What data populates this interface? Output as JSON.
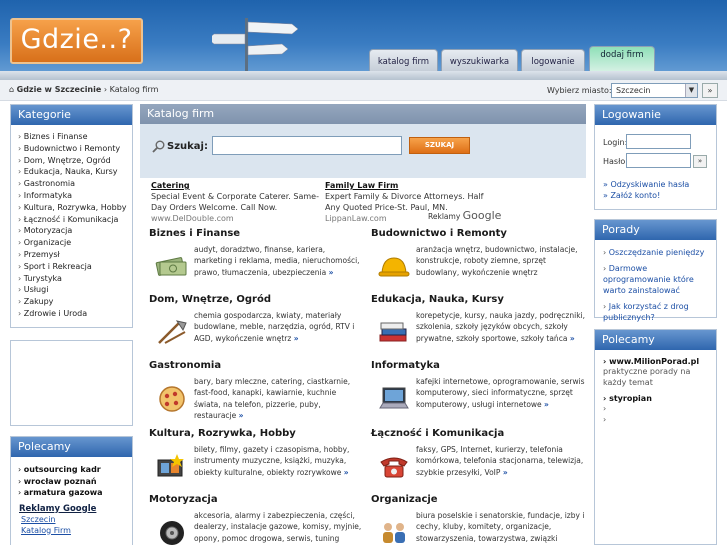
{
  "header": {
    "logo": "Gdzie..?",
    "tabs": [
      "katalog firm",
      "wyszukiwarka",
      "logowanie",
      "dodaj firm"
    ]
  },
  "breadcrumb": {
    "home": "Gdzie w Szczecinie",
    "current": "Katalog firm",
    "city_label": "Wybierz miasto:",
    "city_value": "Szczecin",
    "city_go": "»"
  },
  "kategorie": {
    "title": "Kategorie",
    "items": [
      "Biznes i Finanse",
      "Budownictwo i Remonty",
      "Dom, Wnętrze, Ogród",
      "Edukacja, Nauka, Kursy",
      "Gastronomia",
      "Informatyka",
      "Kultura, Rozrywka, Hobby",
      "Łączność i Komunikacja",
      "Motoryzacja",
      "Organizacje",
      "Przemysł",
      "Sport i Rekreacja",
      "Turystyka",
      "Usługi",
      "Zakupy",
      "Zdrowie i Uroda"
    ]
  },
  "polecany_left": {
    "title": "Polecamy",
    "items": [
      "outsourcing kadr",
      "wrocław poznań",
      "armatura gazowa"
    ],
    "reklamy": "Reklamy Google",
    "links": [
      "Szczecin",
      "Katalog Firm"
    ]
  },
  "center": {
    "title": "Katalog firm",
    "search_label": "Szukaj:",
    "search_value": "",
    "search_button": "SZUKAJ",
    "ads": [
      {
        "title": "Catering",
        "text": "Special Event & Corporate Caterer. Same-Day Orders Welcome. Call Now.",
        "url": "www.DelDouble.com"
      },
      {
        "title": "Family Law Firm",
        "text": "Expert Family & Divorce Attorneys. Half Any Quoted Price-St. Paul, MN.",
        "url": "LippanLaw.com"
      }
    ],
    "ads_by": "Reklamy",
    "ads_google": "Google",
    "more": "»",
    "categories": [
      {
        "title": "Biznes i Finanse",
        "text": "audyt, doradztwo, finanse, kariera, marketing i reklama, media, nieruchomości, prawo, tłumaczenia, ubezpieczenia",
        "icon": "money-icon"
      },
      {
        "title": "Budownictwo i Remonty",
        "text": "aranżacja wnętrz, budownictwo, instalacje, konstrukcje, roboty ziemne, sprzęt budowlany, wykończenie wnętrz",
        "icon": "hardhat-icon"
      },
      {
        "title": "Dom, Wnętrze, Ogród",
        "text": "chemia gospodarcza, kwiaty, materiały budowlane, meble, narzędzia, ogród, RTV i AGD, wykończenie wnętrz",
        "icon": "garden-tools-icon"
      },
      {
        "title": "Edukacja, Nauka, Kursy",
        "text": "korepetycje, kursy, nauka jazdy, podręczniki, szkolenia, szkoły języków obcych, szkoły prywatne, szkoły sportowe, szkoły tańca",
        "icon": "books-icon"
      },
      {
        "title": "Gastronomia",
        "text": "bary, bary mleczne, catering, ciastkarnie, fast-food, kanapki, kawiarnie, kuchnie świata, na telefon, pizzerie, puby, restauracje",
        "icon": "pizza-icon"
      },
      {
        "title": "Informatyka",
        "text": "kafejki internetowe, oprogramowanie, serwis komputerowy, sieci informatyczne, sprzęt komputerowy, usługi internetowe",
        "icon": "laptop-icon"
      },
      {
        "title": "Kultura, Rozrywka, Hobby",
        "text": "bilety, filmy, gazety i czasopisma, hobby, instrumenty muzyczne, książki, muzyka, obiekty kulturalne, obiekty rozrywkowe",
        "icon": "film-icon"
      },
      {
        "title": "Łączność i Komunikacja",
        "text": "faksy, GPS, Internet, kurierzy, telefonia komórkowa, telefonia stacjonarna, telewizja, szybkie przesyłki, VoIP",
        "icon": "phone-icon"
      },
      {
        "title": "Motoryzacja",
        "text": "akcesoria, alarmy i zabezpieczenia, części, dealerzy, instalacje gazowe, komisy, myjnie, opony, pomoc drogowa, serwis, tuning",
        "icon": "tire-icon"
      },
      {
        "title": "Organizacje",
        "text": "biura poselskie i senatorskie, fundacje, izby i cechy, kluby, komitety, organizacje, stowarzyszenia, towarzystwa, związki",
        "icon": "people-icon"
      }
    ]
  },
  "logowanie": {
    "title": "Logowanie",
    "login_label": "Login:",
    "password_label": "Hasło:",
    "go": "»",
    "links": [
      "» Odzyskiwanie hasła",
      "» Załóż konto!"
    ]
  },
  "porady": {
    "title": "Porady",
    "items": [
      "Oszczędzanie pieniędzy",
      "Darmowe oprogramowanie które warto zainstalować",
      "Jak korzystać z drog publicznych?"
    ]
  },
  "polecany_right": {
    "title": "Polecamy",
    "site": "› www.MilionPorad.pl",
    "desc": "praktyczne porady na każdy temat",
    "item": "› styropian",
    "arrows": [
      "›",
      "›"
    ]
  },
  "colors": {
    "header_blue": "#2a6db5",
    "box_header": "#3a6fb4",
    "logo_orange": "#e8852d",
    "link_blue": "#1c4fa5"
  }
}
